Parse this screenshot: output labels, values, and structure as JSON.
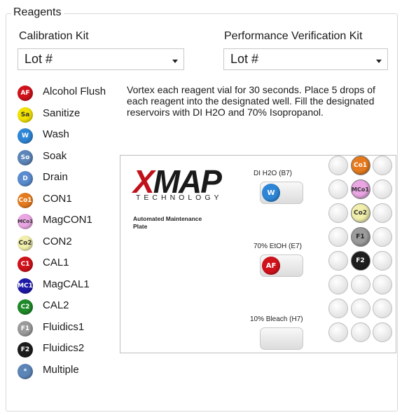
{
  "group_title": "Reagents",
  "calibration": {
    "label": "Calibration Kit",
    "value": "Lot #"
  },
  "verification": {
    "label": "Performance Verification Kit",
    "value": "Lot #"
  },
  "instructions": "Vortex each reagent vial for 30 seconds. Place 5 drops of each reagent into the designated well. Fill the designated reservoirs with DI H2O and 70% Isopropanol.",
  "legend": [
    {
      "badge": "AF",
      "label": "Alcohol Flush",
      "bg": "#d0121b",
      "fg": "#ffffff"
    },
    {
      "badge": "Sa",
      "label": "Sanitize",
      "bg": "#f2e200",
      "fg": "#333333"
    },
    {
      "badge": "W",
      "label": "Wash",
      "bg": "#2f86d6",
      "fg": "#ffffff"
    },
    {
      "badge": "So",
      "label": "Soak",
      "bg": "#5c85b8",
      "fg": "#ffffff"
    },
    {
      "badge": "D",
      "label": "Drain",
      "bg": "#5a8ccf",
      "fg": "#ffffff"
    },
    {
      "badge": "Co1",
      "label": "CON1",
      "bg": "#e57b1e",
      "fg": "#ffffff"
    },
    {
      "badge": "MCo1",
      "label": "MagCON1",
      "bg": "#e9a6e3",
      "fg": "#333333"
    },
    {
      "badge": "Co2",
      "label": "CON2",
      "bg": "#f1efab",
      "fg": "#333333"
    },
    {
      "badge": "C1",
      "label": "CAL1",
      "bg": "#d0121b",
      "fg": "#ffffff"
    },
    {
      "badge": "MC1",
      "label": "MagCAL1",
      "bg": "#1e1aa8",
      "fg": "#ffffff"
    },
    {
      "badge": "C2",
      "label": "CAL2",
      "bg": "#1f8a2a",
      "fg": "#ffffff"
    },
    {
      "badge": "F1",
      "label": "Fluidics1",
      "bg": "#9b9b9b",
      "fg": "#ffffff"
    },
    {
      "badge": "F2",
      "label": "Fluidics2",
      "bg": "#1d1d1d",
      "fg": "#ffffff"
    },
    {
      "badge": "*",
      "label": "Multiple",
      "bg": "#5c85b8",
      "fg": "#ffffff"
    }
  ],
  "plate": {
    "logo_main": "MAP",
    "logo_x": "X",
    "logo_sub": "TECHNOLOGY",
    "caption": "Automated Maintenance Plate",
    "reservoirs": [
      {
        "label": "DI H2O (B7)",
        "badge": "W",
        "bg": "#2f86d6"
      },
      {
        "label": "70% EtOH (E7)",
        "badge": "AF",
        "bg": "#d0121b"
      },
      {
        "label": "10% Bleach (H7)",
        "badge": "",
        "bg": ""
      }
    ],
    "wells": [
      [
        "",
        "Co1",
        ""
      ],
      [
        "",
        "MCo1",
        ""
      ],
      [
        "",
        "Co2",
        ""
      ],
      [
        "",
        "F1",
        ""
      ],
      [
        "",
        "F2",
        ""
      ],
      [
        "",
        "",
        ""
      ],
      [
        "",
        "",
        ""
      ],
      [
        "",
        "",
        ""
      ]
    ],
    "well_colors": {
      "Co1": {
        "bg": "#e57b1e",
        "fg": "#ffffff"
      },
      "MCo1": {
        "bg": "#e9a6e3",
        "fg": "#333333"
      },
      "Co2": {
        "bg": "#f1efab",
        "fg": "#333333"
      },
      "F1": {
        "bg": "#9b9b9b",
        "fg": "#222222"
      },
      "F2": {
        "bg": "#1d1d1d",
        "fg": "#ffffff"
      }
    }
  }
}
